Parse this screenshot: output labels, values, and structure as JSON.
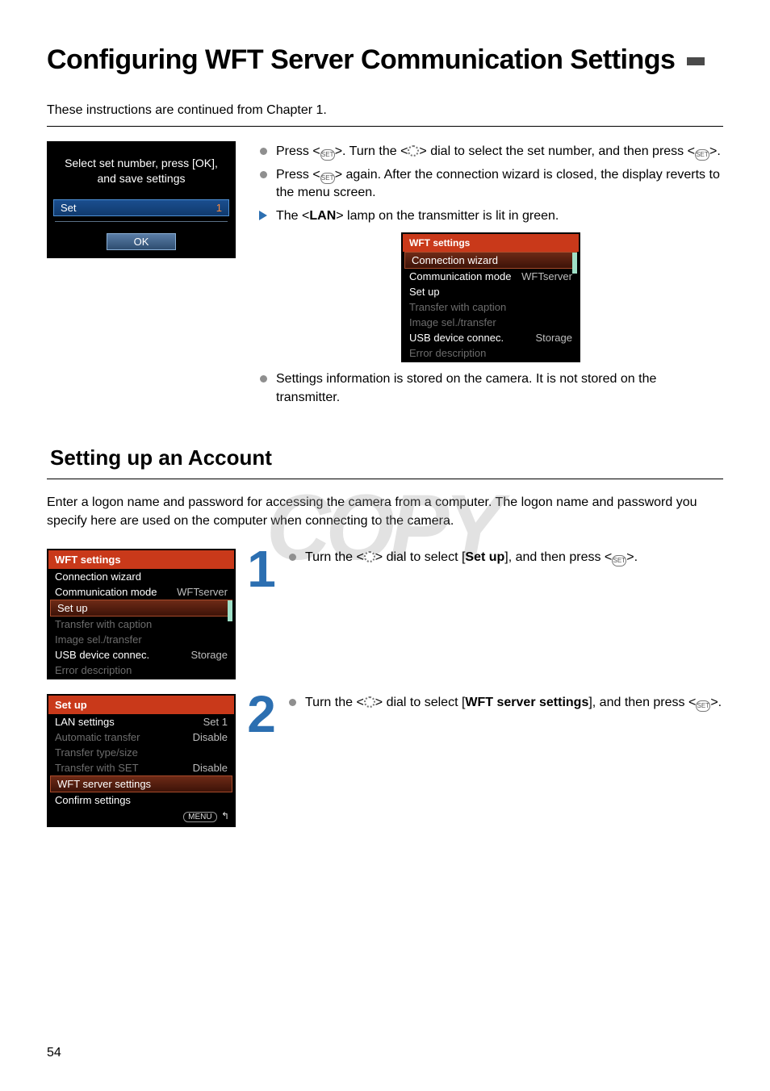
{
  "page_number": "54",
  "title": "Configuring WFT Server Communication Settings",
  "intro": "These instructions are continued from Chapter 1.",
  "watermark": "COPY",
  "top_menu": {
    "instruction_line1": "Select set number, press [OK],",
    "instruction_line2": "and save settings",
    "set_label": "Set",
    "set_value": "1",
    "ok_label": "OK"
  },
  "top_bullets": {
    "b1_pre": "Press <",
    "b1_icon": "SET",
    "b1_mid": ">. Turn the <",
    "b1_post": "> dial to select the set number, and then press <",
    "b1_end": ">.",
    "b2_pre": "Press <",
    "b2_post": "> again. After the connection wizard is closed, the display reverts to the menu screen.",
    "b3_pre": "The <",
    "b3_bold": "LAN",
    "b3_post": "> lamp on the transmitter is lit in green."
  },
  "wft_menu": {
    "title": "WFT settings",
    "items": [
      {
        "label": "Connection wizard",
        "val": "",
        "style": "sel-red",
        "hasbar": true
      },
      {
        "label": "Communication mode",
        "val": "WFTserver",
        "style": ""
      },
      {
        "label": "Set up",
        "val": "",
        "style": ""
      },
      {
        "label": "Transfer with caption",
        "val": "",
        "style": "dim"
      },
      {
        "label": "Image sel./transfer",
        "val": "",
        "style": "dim"
      },
      {
        "label": "USB device connec.",
        "val": "Storage",
        "style": ""
      },
      {
        "label": "Error description",
        "val": "",
        "style": "dim"
      }
    ]
  },
  "info_bullet": "Settings information is stored on the camera. It is not stored on the transmitter.",
  "section_title": "Setting up an Account",
  "section_sub": "Enter a logon name and password for accessing the camera from a computer. The logon name and password you specify here are used on the computer when connecting to the camera.",
  "step1": {
    "number": "1",
    "text_pre": "Turn the <",
    "text_mid": "> dial to select [",
    "text_bold": "Set up",
    "text_post": "], and then press <",
    "text_end": ">.",
    "menu": {
      "title": "WFT settings",
      "items": [
        {
          "label": "Connection wizard",
          "val": "",
          "style": ""
        },
        {
          "label": "Communication mode",
          "val": "WFTserver",
          "style": ""
        },
        {
          "label": "Set up",
          "val": "",
          "style": "sel-red",
          "hasbar": true
        },
        {
          "label": "Transfer with caption",
          "val": "",
          "style": "dim"
        },
        {
          "label": "Image sel./transfer",
          "val": "",
          "style": "dim"
        },
        {
          "label": "USB device connec.",
          "val": "Storage",
          "style": ""
        },
        {
          "label": "Error description",
          "val": "",
          "style": "dim"
        }
      ]
    }
  },
  "step2": {
    "number": "2",
    "text_pre": "Turn the <",
    "text_mid": "> dial to select [",
    "text_bold": "WFT server settings",
    "text_post": "], and then press <",
    "text_end": ">.",
    "menu": {
      "title": "Set up",
      "menu_label": "MENU",
      "items": [
        {
          "label": "LAN settings",
          "val": "Set 1",
          "style": ""
        },
        {
          "label": "Automatic transfer",
          "val": "Disable",
          "style": "dim"
        },
        {
          "label": "Transfer type/size",
          "val": "",
          "style": "dim"
        },
        {
          "label": "Transfer with SET",
          "val": "Disable",
          "style": "dim"
        },
        {
          "label": "WFT server settings",
          "val": "",
          "style": "sel-red"
        },
        {
          "label": "Confirm settings",
          "val": "",
          "style": ""
        }
      ]
    }
  }
}
